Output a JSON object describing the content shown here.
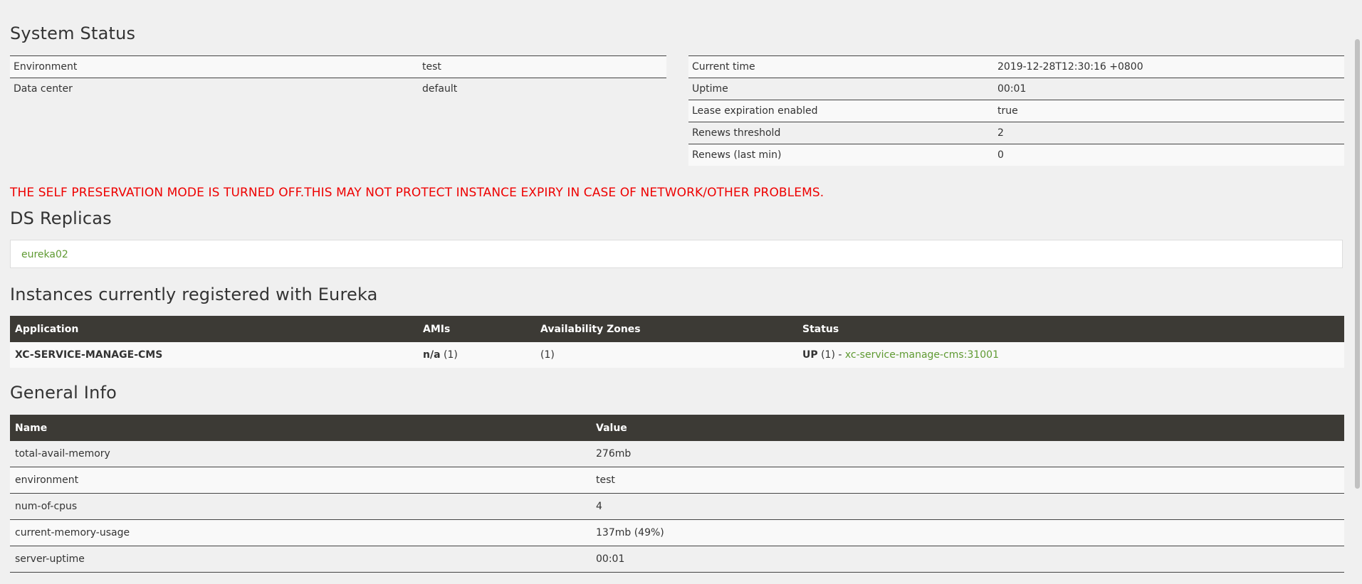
{
  "system_status": {
    "title": "System Status",
    "env_rows": [
      {
        "label": "Environment",
        "value": "test"
      },
      {
        "label": "Data center",
        "value": "default"
      }
    ],
    "time_rows": [
      {
        "label": "Current time",
        "value": "2019-12-28T12:30:16 +0800"
      },
      {
        "label": "Uptime",
        "value": "00:01"
      },
      {
        "label": "Lease expiration enabled",
        "value": "true"
      },
      {
        "label": "Renews threshold",
        "value": "2"
      },
      {
        "label": "Renews (last min)",
        "value": "0"
      }
    ]
  },
  "warning": "THE SELF PRESERVATION MODE IS TURNED OFF.THIS MAY NOT PROTECT INSTANCE EXPIRY IN CASE OF NETWORK/OTHER PROBLEMS.",
  "replicas": {
    "title": "DS Replicas",
    "items": [
      "eureka02"
    ]
  },
  "instances": {
    "title": "Instances currently registered with Eureka",
    "headers": [
      "Application",
      "AMIs",
      "Availability Zones",
      "Status"
    ],
    "rows": [
      {
        "application": "XC-SERVICE-MANAGE-CMS",
        "amis_bold": "n/a",
        "amis_count": "(1)",
        "zones": "(1)",
        "status_bold": "UP",
        "status_count": "(1) -",
        "status_link": "xc-service-manage-cms:31001"
      }
    ]
  },
  "general_info": {
    "title": "General Info",
    "headers": [
      "Name",
      "Value"
    ],
    "rows": [
      {
        "name": "total-avail-memory",
        "value": "276mb"
      },
      {
        "name": "environment",
        "value": "test"
      },
      {
        "name": "num-of-cpus",
        "value": "4"
      },
      {
        "name": "current-memory-usage",
        "value": "137mb (49%)"
      },
      {
        "name": "server-uptime",
        "value": "00:01"
      }
    ]
  },
  "colors": {
    "header_bg": "#3c3a35",
    "warning": "#ee0000",
    "link": "#5f9a32"
  }
}
